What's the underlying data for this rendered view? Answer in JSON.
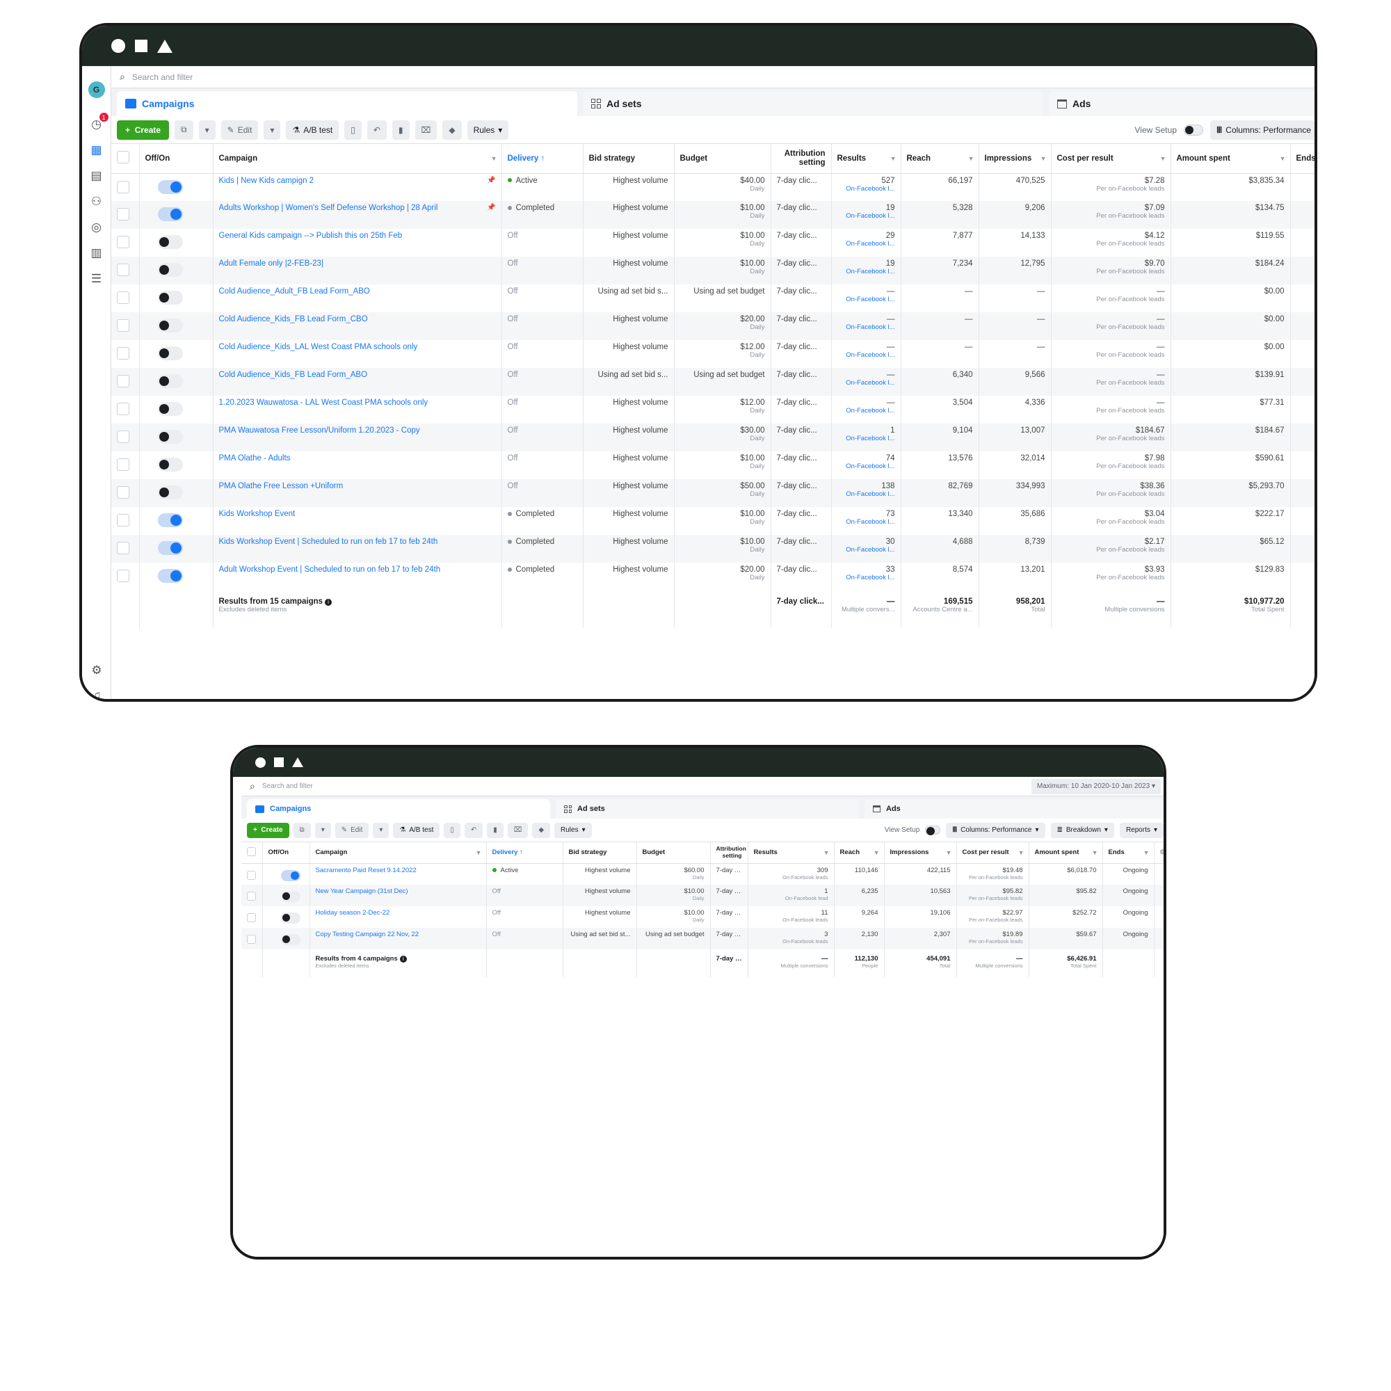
{
  "win1": {
    "search_placeholder": "Search and filter",
    "avatar_letter": "G",
    "notif_count": "1",
    "tabs": {
      "campaigns": "Campaigns",
      "adsets": "Ad sets",
      "ads": "Ads"
    },
    "toolbar": {
      "create": "Create",
      "edit": "Edit",
      "ab": "A/B test",
      "rules": "Rules",
      "view_setup": "View Setup",
      "columns": "Columns: Performance"
    },
    "headers": {
      "offon": "Off/On",
      "campaign": "Campaign",
      "delivery": "Delivery ↑",
      "bid": "Bid strategy",
      "budget": "Budget",
      "attr": "Attribution setting",
      "results": "Results",
      "reach": "Reach",
      "impr": "Impressions",
      "cpr": "Cost per result",
      "spent": "Amount spent",
      "ends": "Ends"
    },
    "rows": [
      {
        "on": true,
        "pin": true,
        "name": "Kids | New Kids campign 2",
        "delivery": "Active",
        "dclass": "g",
        "bid": "Highest volume",
        "budget": "$40.00",
        "budget_sub": "Daily",
        "attr": "7-day clic...",
        "results": "527",
        "results_sub": "On-Facebook l...",
        "reach": "66,197",
        "impr": "470,525",
        "cpr": "$7.28",
        "cpr_sub": "Per on-Facebook leads",
        "spent": "$3,835.34"
      },
      {
        "on": true,
        "pin": true,
        "name": "Adults Workshop | Women's Self Defense Workshop | 28 April",
        "delivery": "Completed",
        "dclass": "gr",
        "bid": "Highest volume",
        "budget": "$10.00",
        "budget_sub": "Daily",
        "attr": "7-day clic...",
        "results": "19",
        "results_sub": "On-Facebook l...",
        "reach": "5,328",
        "impr": "9,206",
        "cpr": "$7.09",
        "cpr_sub": "Per on-Facebook leads",
        "spent": "$134.75"
      },
      {
        "on": false,
        "pin": false,
        "name": "General Kids campaign --> Publish this on 25th Feb",
        "delivery": "Off",
        "dclass": "",
        "bid": "Highest volume",
        "budget": "$10.00",
        "budget_sub": "Daily",
        "attr": "7-day clic...",
        "results": "29",
        "results_sub": "On-Facebook l...",
        "reach": "7,877",
        "impr": "14,133",
        "cpr": "$4.12",
        "cpr_sub": "Per on-Facebook leads",
        "spent": "$119.55"
      },
      {
        "on": false,
        "pin": false,
        "name": "Adult Female only |2-FEB-23|",
        "delivery": "Off",
        "dclass": "",
        "bid": "Highest volume",
        "budget": "$10.00",
        "budget_sub": "Daily",
        "attr": "7-day clic...",
        "results": "19",
        "results_sub": "On-Facebook l...",
        "reach": "7,234",
        "impr": "12,795",
        "cpr": "$9.70",
        "cpr_sub": "Per on-Facebook leads",
        "spent": "$184.24"
      },
      {
        "on": false,
        "pin": false,
        "name": "Cold Audience_Adult_FB Lead Form_ABO",
        "delivery": "Off",
        "dclass": "",
        "bid": "Using ad set bid s...",
        "budget": "Using ad set budget",
        "budget_sub": "",
        "attr": "7-day clic...",
        "results": "—",
        "results_sub": "On-Facebook l...",
        "reach": "—",
        "impr": "—",
        "cpr": "—",
        "cpr_sub": "Per on-Facebook leads",
        "spent": "$0.00"
      },
      {
        "on": false,
        "pin": false,
        "name": "Cold Audience_Kids_FB Lead Form_CBO",
        "delivery": "Off",
        "dclass": "",
        "bid": "Highest volume",
        "budget": "$20.00",
        "budget_sub": "Daily",
        "attr": "7-day clic...",
        "results": "—",
        "results_sub": "On-Facebook l...",
        "reach": "—",
        "impr": "—",
        "cpr": "—",
        "cpr_sub": "Per on-Facebook leads",
        "spent": "$0.00"
      },
      {
        "on": false,
        "pin": false,
        "name": "Cold Audience_Kids_LAL West Coast PMA schools only",
        "delivery": "Off",
        "dclass": "",
        "bid": "Highest volume",
        "budget": "$12.00",
        "budget_sub": "Daily",
        "attr": "7-day clic...",
        "results": "—",
        "results_sub": "On-Facebook l...",
        "reach": "—",
        "impr": "—",
        "cpr": "—",
        "cpr_sub": "Per on-Facebook leads",
        "spent": "$0.00"
      },
      {
        "on": false,
        "pin": false,
        "name": "Cold Audience_Kids_FB Lead Form_ABO",
        "delivery": "Off",
        "dclass": "",
        "bid": "Using ad set bid s...",
        "budget": "Using ad set budget",
        "budget_sub": "",
        "attr": "7-day clic...",
        "results": "—",
        "results_sub": "On-Facebook l...",
        "reach": "6,340",
        "impr": "9,566",
        "cpr": "—",
        "cpr_sub": "Per on-Facebook leads",
        "spent": "$139.91"
      },
      {
        "on": false,
        "pin": false,
        "name": "1.20.2023 Wauwatosa - LAL West Coast PMA schools only",
        "delivery": "Off",
        "dclass": "",
        "bid": "Highest volume",
        "budget": "$12.00",
        "budget_sub": "Daily",
        "attr": "7-day clic...",
        "results": "—",
        "results_sub": "On-Facebook l...",
        "reach": "3,504",
        "impr": "4,336",
        "cpr": "—",
        "cpr_sub": "Per on-Facebook leads",
        "spent": "$77.31"
      },
      {
        "on": false,
        "pin": false,
        "name": "PMA Wauwatosa Free Lesson/Uniform 1.20.2023 - Copy",
        "delivery": "Off",
        "dclass": "",
        "bid": "Highest volume",
        "budget": "$30.00",
        "budget_sub": "Daily",
        "attr": "7-day clic...",
        "results": "1",
        "results_sub": "On-Facebook l...",
        "reach": "9,104",
        "impr": "13,007",
        "cpr": "$184.67",
        "cpr_sub": "Per on-Facebook leads",
        "spent": "$184.67"
      },
      {
        "on": false,
        "pin": false,
        "name": "PMA Olathe - Adults",
        "delivery": "Off",
        "dclass": "",
        "bid": "Highest volume",
        "budget": "$10.00",
        "budget_sub": "Daily",
        "attr": "7-day clic...",
        "results": "74",
        "results_sub": "On-Facebook l...",
        "reach": "13,576",
        "impr": "32,014",
        "cpr": "$7.98",
        "cpr_sub": "Per on-Facebook leads",
        "spent": "$590.61"
      },
      {
        "on": false,
        "pin": false,
        "name": "PMA Olathe Free Lesson +Uniform",
        "delivery": "Off",
        "dclass": "",
        "bid": "Highest volume",
        "budget": "$50.00",
        "budget_sub": "Daily",
        "attr": "7-day clic...",
        "results": "138",
        "results_sub": "On-Facebook l...",
        "reach": "82,769",
        "impr": "334,993",
        "cpr": "$38.36",
        "cpr_sub": "Per on-Facebook leads",
        "spent": "$5,293.70"
      },
      {
        "on": true,
        "pin": false,
        "name": "Kids Workshop Event",
        "delivery": "Completed",
        "dclass": "gr",
        "bid": "Highest volume",
        "budget": "$10.00",
        "budget_sub": "Daily",
        "attr": "7-day clic...",
        "results": "73",
        "results_sub": "On-Facebook l...",
        "reach": "13,340",
        "impr": "35,686",
        "cpr": "$3.04",
        "cpr_sub": "Per on-Facebook leads",
        "spent": "$222.17"
      },
      {
        "on": true,
        "pin": false,
        "name": "Kids Workshop Event | Scheduled to run on feb 17 to feb 24th",
        "delivery": "Completed",
        "dclass": "gr",
        "bid": "Highest volume",
        "budget": "$10.00",
        "budget_sub": "Daily",
        "attr": "7-day clic...",
        "results": "30",
        "results_sub": "On-Facebook l...",
        "reach": "4,688",
        "impr": "8,739",
        "cpr": "$2.17",
        "cpr_sub": "Per on-Facebook leads",
        "spent": "$65.12"
      },
      {
        "on": true,
        "pin": false,
        "name": "Adult Workshop Event | Scheduled to run on feb 17 to feb 24th",
        "delivery": "Completed",
        "dclass": "gr",
        "bid": "Highest volume",
        "budget": "$20.00",
        "budget_sub": "Daily",
        "attr": "7-day clic...",
        "results": "33",
        "results_sub": "On-Facebook l...",
        "reach": "8,574",
        "impr": "13,201",
        "cpr": "$3.93",
        "cpr_sub": "Per on-Facebook leads",
        "spent": "$129.83"
      }
    ],
    "summary": {
      "label": "Results from 15 campaigns",
      "sub": "Excludes deleted items",
      "attr": "7-day click...",
      "results": "—",
      "results_sub": "Multiple convers...",
      "reach": "169,515",
      "reach_sub": "Accounts Centre a...",
      "impr": "958,201",
      "impr_sub": "Total",
      "cpr": "—",
      "cpr_sub": "Multiple conversions",
      "spent": "$10,977.20",
      "spent_sub": "Total Spent"
    }
  },
  "win2": {
    "search_placeholder": "Search and filter",
    "date_range": "Maximum: 10 Jan 2020-10 Jan 2023",
    "tabs": {
      "campaigns": "Campaigns",
      "adsets": "Ad sets",
      "ads": "Ads"
    },
    "toolbar": {
      "create": "Create",
      "edit": "Edit",
      "ab": "A/B test",
      "rules": "Rules",
      "view_setup": "View Setup",
      "columns": "Columns: Performance",
      "breakdown": "Breakdown",
      "reports": "Reports"
    },
    "headers": {
      "offon": "Off/On",
      "campaign": "Campaign",
      "delivery": "Delivery ↑",
      "bid": "Bid strategy",
      "budget": "Budget",
      "attr": "Attribution setting",
      "results": "Results",
      "reach": "Reach",
      "impr": "Impressions",
      "cpr": "Cost per result",
      "spent": "Amount spent",
      "ends": "Ends"
    },
    "rows": [
      {
        "on": true,
        "name": "Sacramento Paid Reset 9.14.2022",
        "delivery": "Active",
        "dclass": "g",
        "bid": "Highest volume",
        "budget": "$60.00",
        "budget_sub": "Daily",
        "attr": "7-day c...",
        "results": "309",
        "results_sub": "On-Facebook leads",
        "reach": "110,146",
        "impr": "422,115",
        "cpr": "$19.48",
        "cpr_sub": "Per on-Facebook leads",
        "spent": "$6,018.70",
        "ends": "Ongoing"
      },
      {
        "on": false,
        "name": "New Year Campaign (31st Dec)",
        "delivery": "Off",
        "dclass": "",
        "bid": "Highest volume",
        "budget": "$10.00",
        "budget_sub": "Daily",
        "attr": "7-day c...",
        "results": "1",
        "results_sub": "On-Facebook lead",
        "reach": "6,235",
        "impr": "10,563",
        "cpr": "$95.82",
        "cpr_sub": "Per on-Facebook leads",
        "spent": "$95.82",
        "ends": "Ongoing"
      },
      {
        "on": false,
        "name": "Holiday season 2-Dec-22",
        "delivery": "Off",
        "dclass": "",
        "bid": "Highest volume",
        "budget": "$10.00",
        "budget_sub": "Daily",
        "attr": "7-day c...",
        "results": "11",
        "results_sub": "On-Facebook leads",
        "reach": "9,264",
        "impr": "19,106",
        "cpr": "$22.97",
        "cpr_sub": "Per on-Facebook leads",
        "spent": "$252.72",
        "ends": "Ongoing"
      },
      {
        "on": false,
        "name": "Copy Testing Campaign 22 Nov, 22",
        "delivery": "Off",
        "dclass": "",
        "bid": "Using ad set bid st...",
        "budget": "Using ad set budget",
        "budget_sub": "",
        "attr": "7-day c...",
        "results": "3",
        "results_sub": "On-Facebook leads",
        "reach": "2,130",
        "impr": "2,307",
        "cpr": "$19.89",
        "cpr_sub": "Per on-Facebook leads",
        "spent": "$59.67",
        "ends": "Ongoing"
      }
    ],
    "summary": {
      "label": "Results from 4 campaigns",
      "sub": "Excludes deleted items",
      "attr": "7-day cl...",
      "results": "—",
      "results_sub": "Multiple conversions",
      "reach": "112,130",
      "reach_sub": "People",
      "impr": "454,091",
      "impr_sub": "Total",
      "cpr": "—",
      "cpr_sub": "Multiple conversions",
      "spent": "$6,426.91",
      "spent_sub": "Total Spent"
    }
  },
  "colors": {
    "accent": "#1877f2",
    "create": "#36a420",
    "titlebar": "#1f2a24"
  }
}
